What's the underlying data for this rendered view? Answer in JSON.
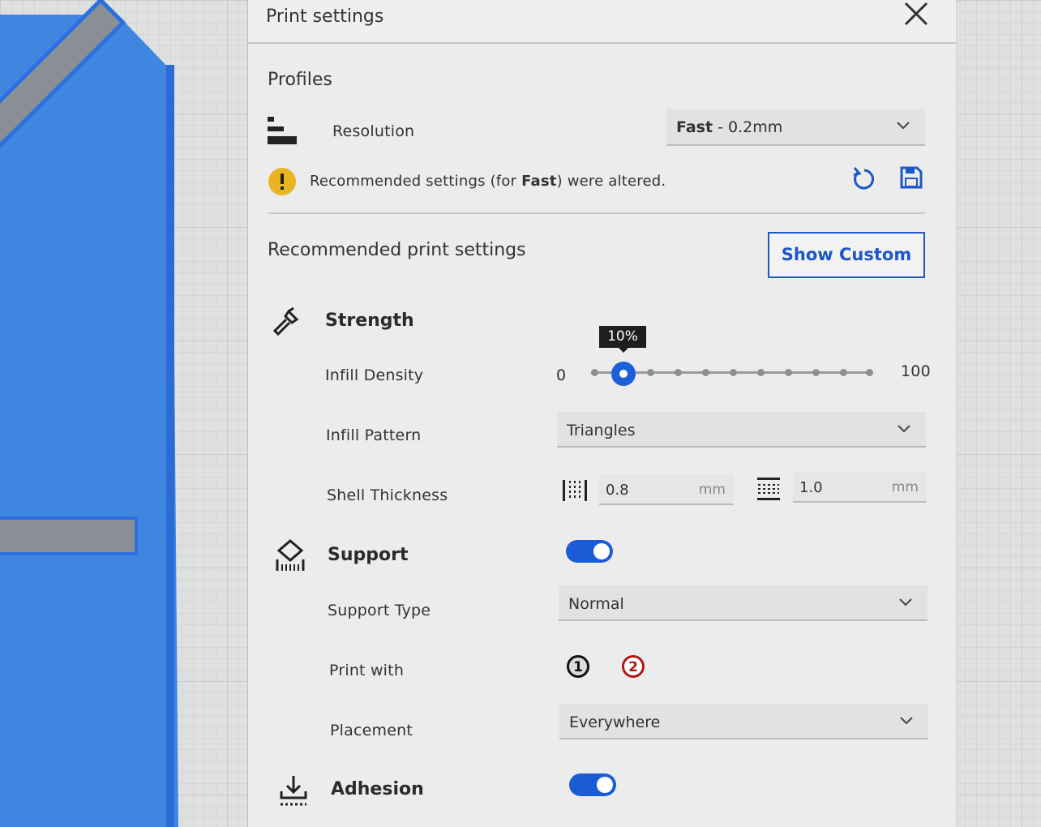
{
  "panel": {
    "title": "Print settings"
  },
  "profiles": {
    "title": "Profiles",
    "resolution_label": "Resolution",
    "resolution_value": "Fast",
    "resolution_detail": " - 0.2mm",
    "warning_prefix": "Recommended settings (for ",
    "warning_bold": "Fast",
    "warning_suffix": ") were altered."
  },
  "recommended": {
    "title": "Recommended print settings",
    "show_custom_label": "Show Custom"
  },
  "strength": {
    "heading": "Strength",
    "infill_density_label": "Infill Density",
    "slider_min": "0",
    "slider_max": "100",
    "slider_tooltip": "10%",
    "slider_value_percent": 10,
    "infill_pattern_label": "Infill Pattern",
    "infill_pattern_value": "Triangles",
    "shell_thickness_label": "Shell Thickness",
    "wall_value": "0.8",
    "wall_unit": "mm",
    "top_bottom_value": "1.0",
    "top_bottom_unit": "mm"
  },
  "support": {
    "heading": "Support",
    "enabled": true,
    "support_type_label": "Support Type",
    "support_type_value": "Normal",
    "print_with_label": "Print with",
    "extruder_1": "1",
    "extruder_2": "2",
    "placement_label": "Placement",
    "placement_value": "Everywhere"
  },
  "adhesion": {
    "heading": "Adhesion",
    "enabled": true
  },
  "colors": {
    "accent": "#1b57c8",
    "warning": "#e8b422",
    "model_blue": "#3f86e0",
    "extruder_2": "#b01818"
  }
}
